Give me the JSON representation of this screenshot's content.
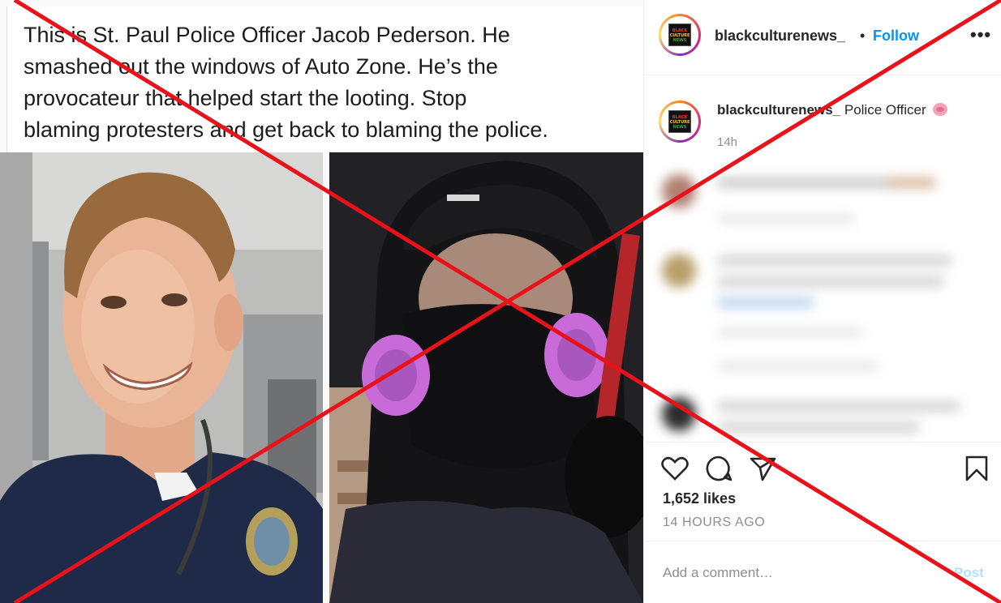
{
  "post": {
    "caption_lines": [
      "This is St. Paul Police Officer Jacob Pederson. He",
      "smashed out the windows of Auto Zone. He’s the",
      "provocateur that helped start the looting. Stop",
      "blaming protesters and get back to blaming the police."
    ]
  },
  "header": {
    "username": "blackculturenews_",
    "separator": "•",
    "follow_label": "Follow",
    "more_label": "•••",
    "avatar_logo_lines": [
      "BLACK",
      "CULTURE",
      "NEWS"
    ]
  },
  "caption": {
    "username": "blackculturenews_",
    "text": "Police Officer",
    "emoji_icon": "pig-face-icon",
    "time": "14h"
  },
  "actions": {
    "icons": [
      "heart-icon",
      "comment-icon",
      "share-icon",
      "bookmark-icon"
    ],
    "likes": "1,652 likes",
    "timestamp": "14 HOURS AGO"
  },
  "comment_box": {
    "placeholder": "Add a comment…",
    "post_label": "Post"
  },
  "colors": {
    "accent": "#0095f6",
    "cross": "#e8121a",
    "respirator": "#c86bd9"
  }
}
